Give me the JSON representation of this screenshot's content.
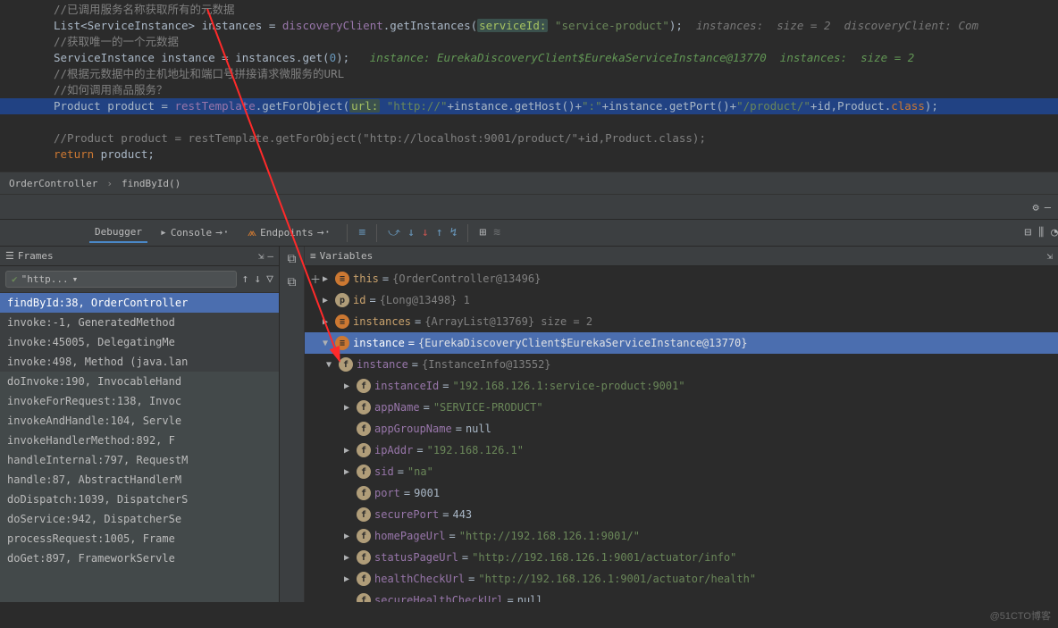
{
  "editor": {
    "l1": "//已调用服务名称获取所有的元数据",
    "l2a": "List<ServiceInstance> instances = ",
    "l2b": "discoveryClient",
    "l2c": ".getInstances(",
    "l2lbl": "serviceId:",
    "l2d": "\"service-product\"",
    "l2e": ");",
    "l2hint": "  instances:  size = 2  discoveryClient: Com",
    "l3": "//获取唯一的一个元数据",
    "l4a": "ServiceInstance instance = instances.get(",
    "l4b": "0",
    "l4c": ");",
    "l4hint": "   instance: EurekaDiscoveryClient$EurekaServiceInstance@13770  instances:  size = 2",
    "l5": "//根据元数据中的主机地址和端口号拼接请求微服务的URL",
    "l6": "//如何调用商品服务？",
    "l7a": "Product product = ",
    "l7b": "restTemplate",
    "l7c": ".getForObject(",
    "l7lbl": "url:",
    "l7d": "\"http://\"",
    "l7e": "+instance.getHost()+",
    "l7f": "\":\"",
    "l7g": "+instance.getPort()+",
    "l7h": "\"/product/\"",
    "l7i": "+id,Product.",
    "l7j": "class",
    "l7k": ");",
    "l8": "//Product product = restTemplate.getForObject(\"http://localhost:9001/product/\"+id,Product.class);",
    "l9a": "return",
    "l9b": " product;"
  },
  "breadcrumb": {
    "a": "OrderController",
    "b": "findById()"
  },
  "tabs": {
    "debugger": "Debugger",
    "console": "Console",
    "endpoints": "Endpoints"
  },
  "frames": {
    "title": "Frames",
    "thread": "\"http...",
    "list": [
      "findById:38, OrderController",
      "invoke:-1, GeneratedMethod",
      "invoke:45005, DelegatingMe",
      "invoke:498, Method (java.lan",
      "doInvoke:190, InvocableHand",
      "invokeForRequest:138, Invoc",
      "invokeAndHandle:104, Servle",
      "invokeHandlerMethod:892, F",
      "handleInternal:797, RequestM",
      "handle:87, AbstractHandlerM",
      "doDispatch:1039, DispatcherS",
      "doService:942, DispatcherSe",
      "processRequest:1005, Frame",
      "doGet:897, FrameworkServle"
    ]
  },
  "vars": {
    "title": "Variables",
    "this_n": "this",
    "this_v": "{OrderController@13496}",
    "id_n": "id",
    "id_v": "{Long@13498} 1",
    "instances_n": "instances",
    "instances_v": "{ArrayList@13769}  size = 2",
    "instance_n": "instance",
    "instance_v": "{EurekaDiscoveryClient$EurekaServiceInstance@13770}",
    "inner_n": "instance",
    "inner_v": "{InstanceInfo@13552}",
    "p_instanceId_n": "instanceId",
    "p_instanceId_v": "\"192.168.126.1:service-product:9001\"",
    "p_appName_n": "appName",
    "p_appName_v": "\"SERVICE-PRODUCT\"",
    "p_appGroupName_n": "appGroupName",
    "p_appGroupName_v": "null",
    "p_ipAddr_n": "ipAddr",
    "p_ipAddr_v": "\"192.168.126.1\"",
    "p_sid_n": "sid",
    "p_sid_v": "\"na\"",
    "p_port_n": "port",
    "p_port_v": "9001",
    "p_securePort_n": "securePort",
    "p_securePort_v": "443",
    "p_homePageUrl_n": "homePageUrl",
    "p_homePageUrl_v": "\"http://192.168.126.1:9001/\"",
    "p_statusPageUrl_n": "statusPageUrl",
    "p_statusPageUrl_v": "\"http://192.168.126.1:9001/actuator/info\"",
    "p_healthCheckUrl_n": "healthCheckUrl",
    "p_healthCheckUrl_v": "\"http://192.168.126.1:9001/actuator/health\"",
    "p_secureHealthCheckUrl_n": "secureHealthCheckUrl",
    "p_secureHealthCheckUrl_v": "null"
  },
  "watermark": "@51CTO博客"
}
